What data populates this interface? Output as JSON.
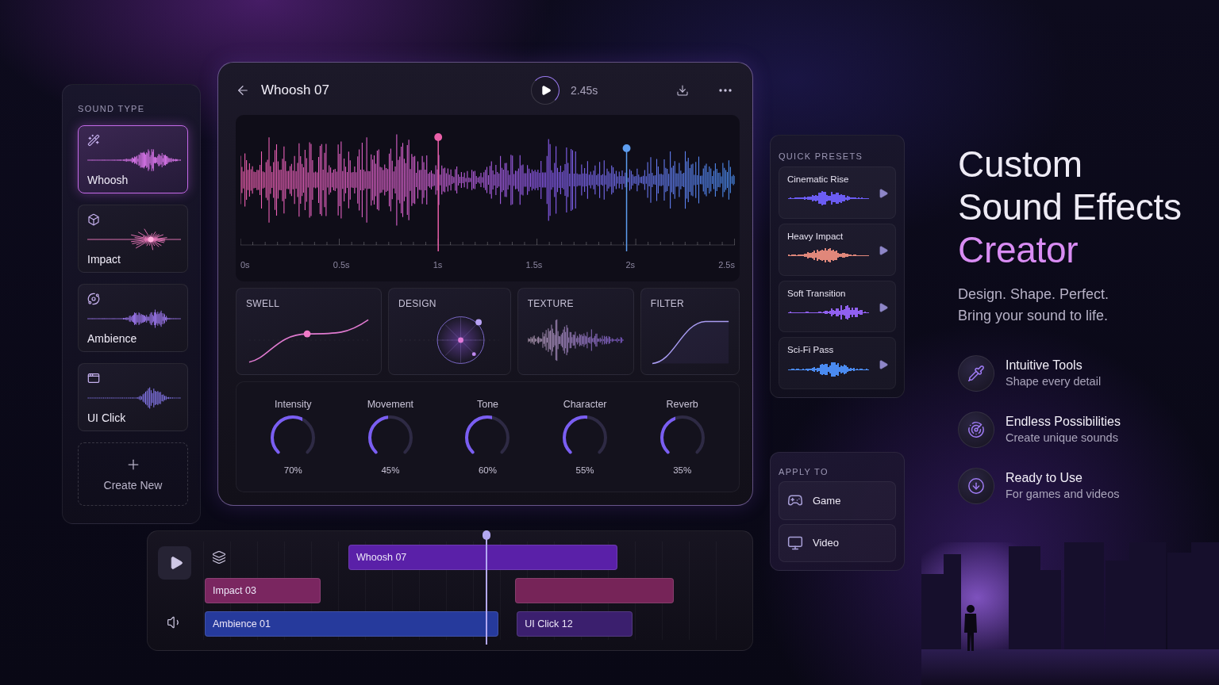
{
  "sound_types": {
    "title": "SOUND TYPE",
    "items": [
      {
        "name": "Whoosh",
        "kind": "spray",
        "selected": true
      },
      {
        "name": "Impact",
        "kind": "burst",
        "selected": false
      },
      {
        "name": "Ambience",
        "kind": "swell",
        "selected": false
      },
      {
        "name": "UI Click",
        "kind": "pulse",
        "selected": false
      }
    ],
    "create_label": "Create New"
  },
  "editor": {
    "title": "Whoosh 07",
    "duration": "2.45s",
    "time_ticks": [
      "0s",
      "0.5s",
      "1s",
      "1.5s",
      "2s",
      "2.5s"
    ],
    "modules": [
      {
        "label": "SWELL",
        "kind": "envelope"
      },
      {
        "label": "DESIGN",
        "kind": "radar"
      },
      {
        "label": "TEXTURE",
        "kind": "texture"
      },
      {
        "label": "FILTER",
        "kind": "filter"
      }
    ],
    "knobs": [
      {
        "label": "Intensity",
        "level": 0.7,
        "reading": "70%"
      },
      {
        "label": "Movement",
        "level": 0.45,
        "reading": "45%"
      },
      {
        "label": "Tone",
        "level": 0.6,
        "reading": "60%"
      },
      {
        "label": "Character",
        "level": 0.55,
        "reading": "55%"
      },
      {
        "label": "Reverb",
        "level": 0.35,
        "reading": "35%"
      }
    ]
  },
  "timeline": {
    "tracks": [
      {
        "clips": [
          {
            "label": "Whoosh 07",
            "color": "#5a20a8"
          }
        ]
      },
      {
        "clips": [
          {
            "label": "Impact 03",
            "color": "#7a2660"
          },
          {
            "color": "#762458"
          }
        ]
      },
      {
        "clips": [
          {
            "label": "Ambience 01",
            "color": "#263a9c"
          },
          {
            "label": "UI Click 12",
            "color": "#3b1f6e"
          }
        ]
      }
    ]
  },
  "quick_presets": {
    "title": "QUICK PRESETS",
    "items": [
      {
        "name": "Cinematic Rise",
        "color": "#6b5cf2"
      },
      {
        "name": "Heavy Impact",
        "color": "#e0877a"
      },
      {
        "name": "Soft Transition",
        "color": "#9060f0"
      },
      {
        "name": "Sci-Fi Pass",
        "color": "#4a8af0"
      }
    ]
  },
  "apply_to": {
    "title": "APPLY TO",
    "options": [
      "Game",
      "Video"
    ]
  },
  "hero": {
    "title_lines": [
      "Custom",
      "Sound Effects"
    ],
    "title_accent": "Creator",
    "tagline": [
      "Design. Shape. Perfect.",
      "Bring your sound to life."
    ],
    "features": [
      {
        "title": "Intuitive Tools",
        "subtitle": "Shape every detail"
      },
      {
        "title": "Endless Possibilities",
        "subtitle": "Create unique sounds"
      },
      {
        "title": "Ready to Use",
        "subtitle": "For games and videos"
      }
    ]
  }
}
